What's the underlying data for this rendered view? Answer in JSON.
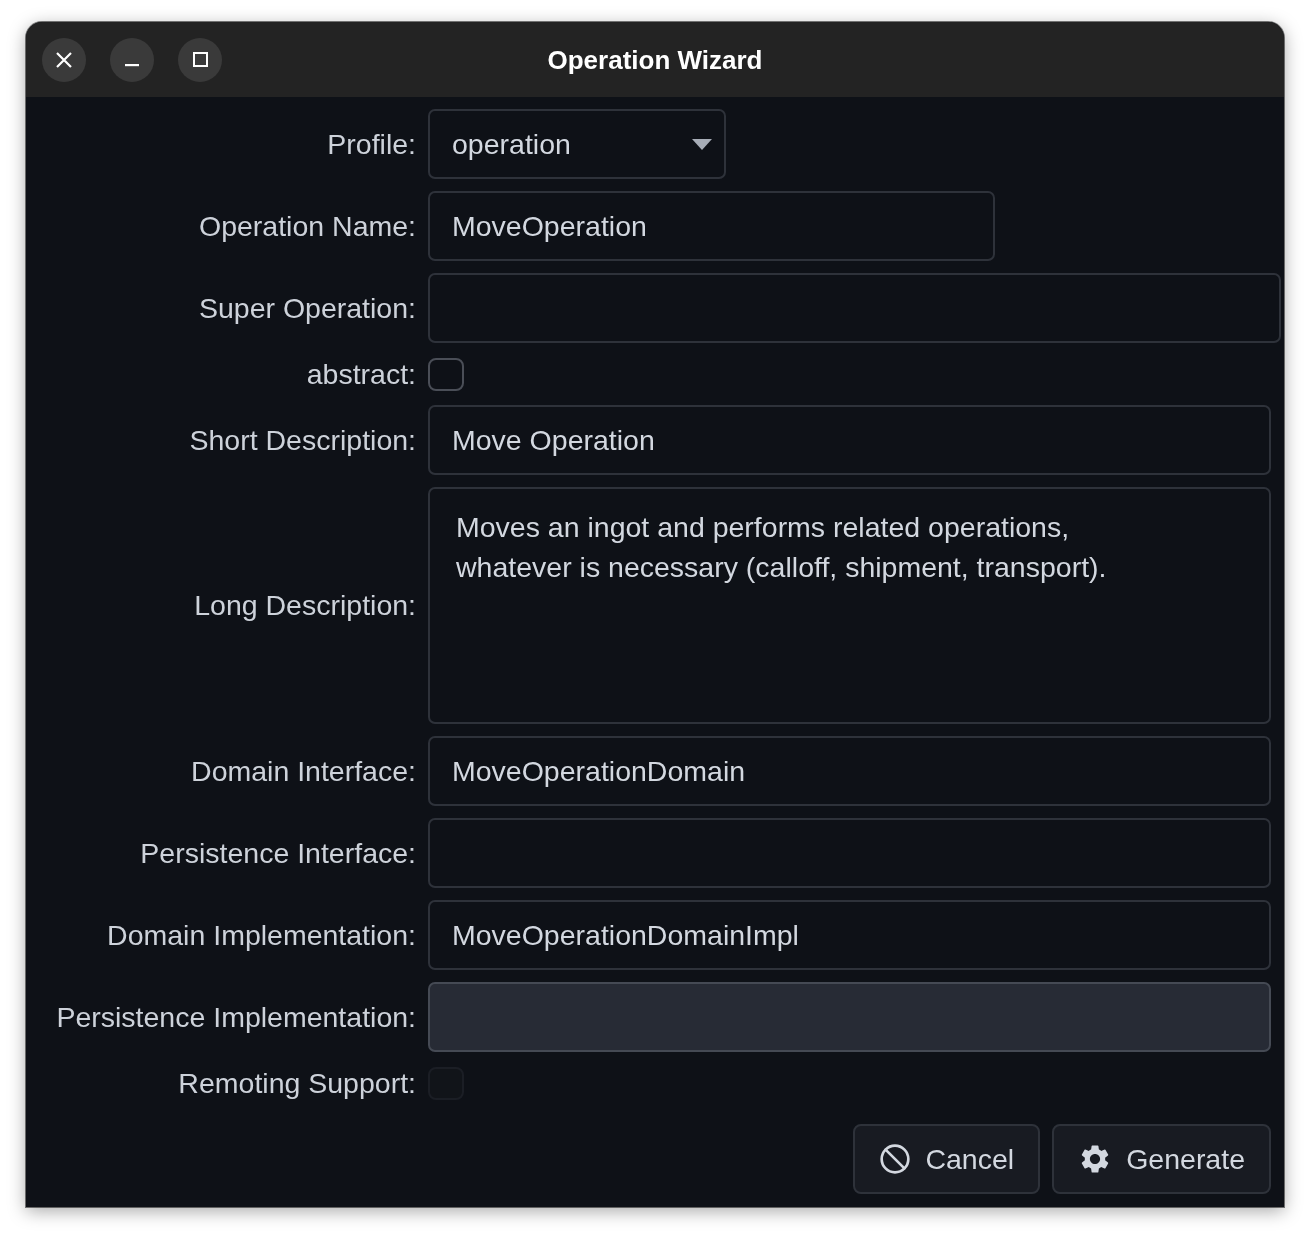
{
  "window": {
    "title": "Operation Wizard"
  },
  "form": {
    "fields": [
      {
        "kind": "dropdown",
        "label": "Profile:",
        "value": "operation",
        "disabled": false
      },
      {
        "kind": "text",
        "label": "Operation Name:",
        "value": "MoveOperation",
        "disabled": false
      },
      {
        "kind": "text",
        "label": "Super Operation:",
        "disabled": false
      },
      {
        "kind": "checkbox",
        "label": "abstract:",
        "checked": false,
        "disabled": false
      },
      {
        "kind": "text",
        "label": "Short Description:",
        "value": "Move Operation",
        "disabled": false
      },
      {
        "kind": "textarea",
        "label": "Long Description:",
        "value": "Moves an ingot and performs related operations,\nwhatever is necessary (calloff, shipment, transport).",
        "disabled": false
      },
      {
        "kind": "text",
        "label": "Domain Interface:",
        "value": "MoveOperationDomain",
        "disabled": false
      },
      {
        "kind": "text",
        "label": "Persistence Interface:",
        "disabled": false
      },
      {
        "kind": "text",
        "label": "Domain Implementation:",
        "value": "MoveOperationDomainImpl",
        "disabled": false
      },
      {
        "kind": "text",
        "label": "Persistence Implementation:",
        "disabled": true
      },
      {
        "kind": "checkbox",
        "label": "Remoting Support:",
        "checked": false,
        "disabled": true
      }
    ]
  },
  "buttons": [
    {
      "kind": "cancel",
      "label": "Cancel"
    },
    {
      "kind": "generate",
      "label": "Generate"
    }
  ]
}
